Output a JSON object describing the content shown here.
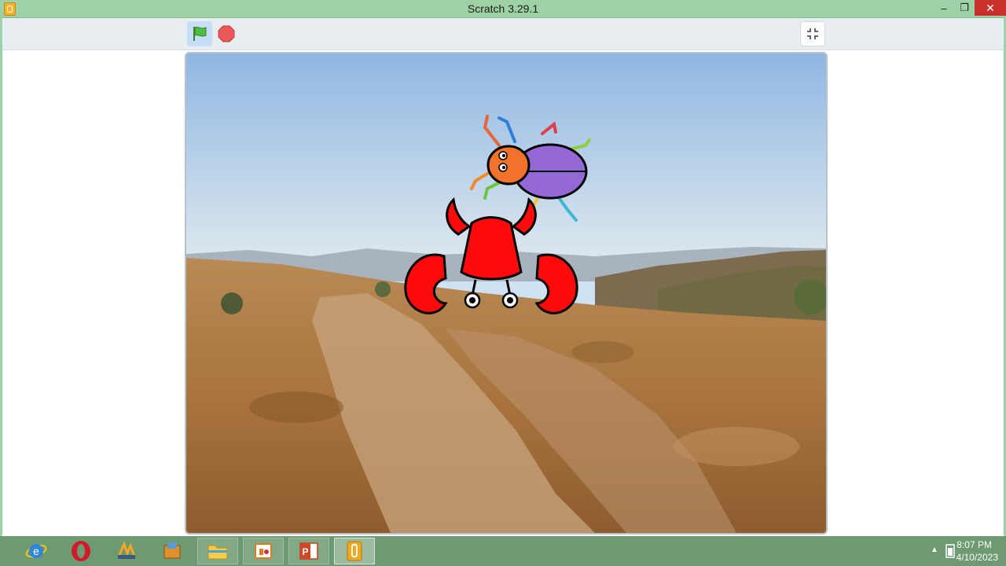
{
  "window": {
    "title": "Scratch 3.29.1",
    "minimize_glyph": "–",
    "restore_glyph": "❐",
    "close_glyph": "✕"
  },
  "player": {
    "green_flag_icon": "green-flag-icon",
    "stop_icon": "stop-icon",
    "fullscreen_icon": "exit-fullscreen-icon"
  },
  "stage": {
    "backdrop": "desert-canyon-trail",
    "sprites": [
      "beetle",
      "crab"
    ]
  },
  "taskbar": {
    "apps": [
      {
        "name": "internet-explorer-icon",
        "state": "pinned"
      },
      {
        "name": "opera-icon",
        "state": "pinned"
      },
      {
        "name": "winamp-icon",
        "state": "pinned"
      },
      {
        "name": "installer-icon",
        "state": "pinned"
      },
      {
        "name": "file-explorer-icon",
        "state": "open"
      },
      {
        "name": "media-player-icon",
        "state": "open"
      },
      {
        "name": "powerpoint-icon",
        "state": "open"
      },
      {
        "name": "scratch-icon",
        "state": "active"
      }
    ],
    "tray": {
      "chevron": "▲",
      "time": "8:07 PM",
      "date": "4/10/2023"
    }
  },
  "colors": {
    "titlebar": "#9fd1a7",
    "taskbar": "#6e9a72",
    "close_button": "#c7312a",
    "flag_active_bg": "#c7dff6"
  }
}
